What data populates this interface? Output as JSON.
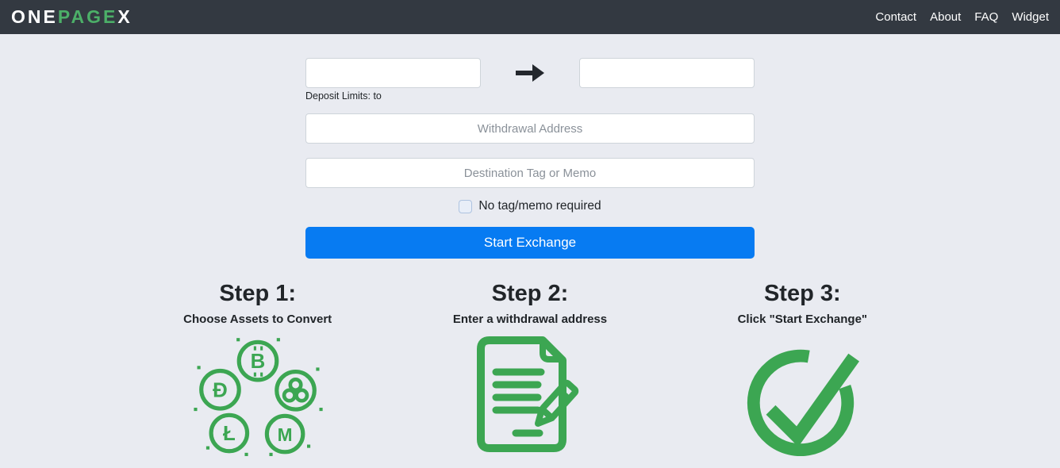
{
  "navbar": {
    "logo": {
      "part1": "ONE",
      "part2": "PAGE",
      "part3": "X"
    },
    "links": [
      {
        "label": "Contact"
      },
      {
        "label": "About"
      },
      {
        "label": "FAQ"
      },
      {
        "label": "Widget"
      }
    ]
  },
  "form": {
    "from_currency_value": "",
    "to_currency_value": "",
    "arrow_icon": "arrow-right-icon",
    "deposit_limits_label": "Deposit Limits: to",
    "withdrawal_address_placeholder": "Withdrawal Address",
    "destination_tag_placeholder": "Destination Tag or Memo",
    "no_tag_checkbox": {
      "checked": false,
      "label": "No tag/memo required"
    },
    "start_exchange_label": "Start Exchange"
  },
  "steps": [
    {
      "title": "Step 1:",
      "subtitle": "Choose Assets to Convert",
      "icon": "crypto-assets-icon"
    },
    {
      "title": "Step 2:",
      "subtitle": "Enter a withdrawal address",
      "icon": "document-pencil-icon"
    },
    {
      "title": "Step 3:",
      "subtitle": "Click \"Start Exchange\"",
      "icon": "check-circle-icon"
    }
  ],
  "colors": {
    "navbar_bg": "#333941",
    "page_bg": "#e9ebf1",
    "brand_green": "#3ca652",
    "logo_green": "#4caf68",
    "button_blue": "#077bf2"
  }
}
